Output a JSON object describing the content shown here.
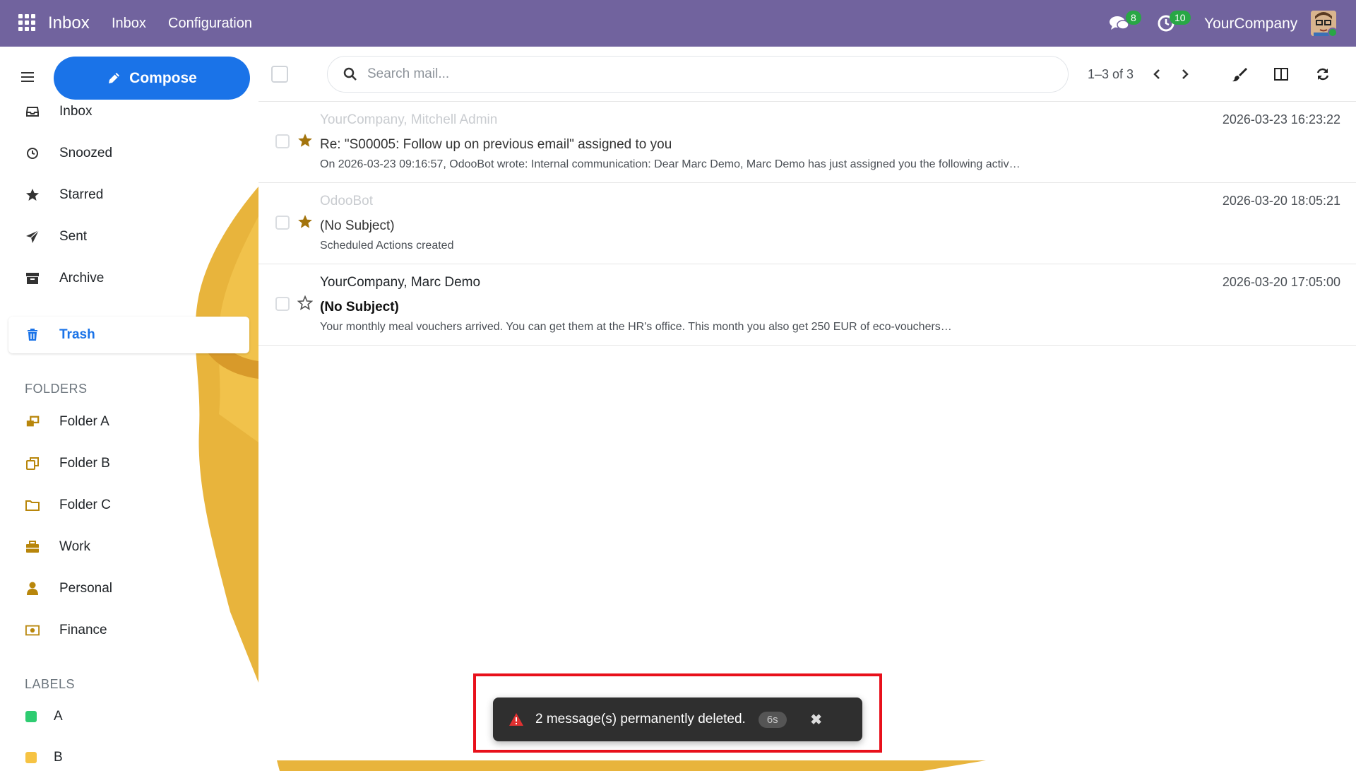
{
  "navbar": {
    "brand": "Inbox",
    "links": [
      "Inbox",
      "Configuration"
    ],
    "messages_badge": "8",
    "activities_badge": "10",
    "company": "YourCompany",
    "bg_color": "#71639e"
  },
  "sidebar": {
    "compose_label": "Compose",
    "items": [
      {
        "label": "Inbox",
        "icon": "inbox-icon"
      },
      {
        "label": "Snoozed",
        "icon": "clock-icon"
      },
      {
        "label": "Starred",
        "icon": "star-icon"
      },
      {
        "label": "Sent",
        "icon": "paper-plane-icon"
      },
      {
        "label": "Archive",
        "icon": "archive-box-icon"
      },
      {
        "label": "Trash",
        "icon": "trash-icon",
        "active": true
      }
    ],
    "folders_title": "FOLDERS",
    "folders": [
      {
        "label": "Folder A",
        "icon": "folder-stack-icon"
      },
      {
        "label": "Folder B",
        "icon": "clone-icon"
      },
      {
        "label": "Folder C",
        "icon": "folder-outline-icon"
      },
      {
        "label": "Work",
        "icon": "briefcase-icon"
      },
      {
        "label": "Personal",
        "icon": "user-icon"
      },
      {
        "label": "Finance",
        "icon": "money-icon"
      }
    ],
    "labels_title": "LABELS",
    "labels": [
      {
        "label": "A",
        "color": "#2ecc71"
      },
      {
        "label": "B",
        "color": "#f6c343"
      }
    ]
  },
  "toolbar": {
    "search_placeholder": "Search mail...",
    "pager": "1–3 of 3"
  },
  "messages": [
    {
      "sender": "YourCompany, Mitchell Admin",
      "subject": "Re: \"S00005: Follow up on previous email\" assigned to you",
      "preview": "On 2026-03-23 09:16:57, OdooBot wrote: Internal communication: Dear Marc Demo, Marc Demo has just assigned you the following activ…",
      "date": "2026-03-23 16:23:22",
      "starred": true,
      "unread": false
    },
    {
      "sender": "OdooBot",
      "subject": "(No Subject)",
      "preview": "Scheduled Actions created",
      "date": "2026-03-20 18:05:21",
      "starred": true,
      "unread": false
    },
    {
      "sender": "YourCompany, Marc Demo",
      "subject": "(No Subject)",
      "preview": "Your monthly meal vouchers arrived. You can get them at the HR's office. This month you also get 250 EUR of eco-vouchers…",
      "date": "2026-03-20 17:05:00",
      "starred": false,
      "unread": true
    }
  ],
  "toast": {
    "text": "2 message(s) permanently deleted.",
    "timer": "6s"
  },
  "colors": {
    "accent": "#1a73e8",
    "star": "#a3740d",
    "folder_icon": "#b8860b",
    "highlight": "#e8101b"
  }
}
